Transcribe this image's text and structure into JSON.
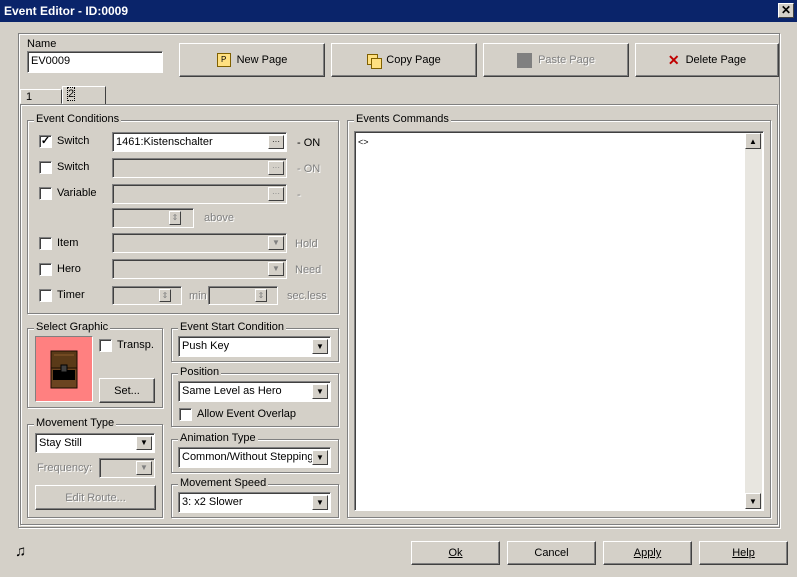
{
  "window": {
    "title": "Event Editor - ID:0009",
    "close_glyph": "✕"
  },
  "name": {
    "label": "Name",
    "value": "EV0009"
  },
  "toolbar": {
    "new_page": "New Page",
    "copy_page": "Copy Page",
    "paste_page": "Paste Page",
    "delete_page": "Delete Page"
  },
  "tabs": [
    "1",
    "2"
  ],
  "event_conditions": {
    "title": "Event Conditions",
    "switch1": {
      "label": "Switch",
      "checked": "✓",
      "value": "1461:Kistenschalter",
      "suffix": "- ON"
    },
    "switch2": {
      "label": "Switch",
      "suffix": "- ON"
    },
    "variable": {
      "label": "Variable",
      "suffix": "-",
      "above": "above"
    },
    "item": {
      "label": "Item",
      "suffix": "Hold"
    },
    "hero": {
      "label": "Hero",
      "suffix": "Need"
    },
    "timer": {
      "label": "Timer",
      "min": "min",
      "sec": "sec.less"
    }
  },
  "select_graphic": {
    "title": "Select Graphic",
    "transp": "Transp.",
    "set": "Set...",
    "bg_color": "#ff8080"
  },
  "movement_type": {
    "title": "Movement Type",
    "value": "Stay Still",
    "frequency": "Frequency:",
    "edit_route": "Edit Route..."
  },
  "event_start": {
    "title": "Event Start Condition",
    "value": "Push Key"
  },
  "position": {
    "title": "Position",
    "value": "Same Level as Hero",
    "overlap": "Allow Event Overlap"
  },
  "animation_type": {
    "title": "Animation Type",
    "value": "Common/Without Stepping"
  },
  "movement_speed": {
    "title": "Movement Speed",
    "value": "3: x2 Slower"
  },
  "events_commands": {
    "title": "Events Commands",
    "first_line": "<>"
  },
  "footer": {
    "ok": "Ok",
    "cancel": "Cancel",
    "apply": "Apply",
    "help": "Help",
    "music_icon": "♫"
  },
  "icons": {
    "ellipsis": "···",
    "down": "▼",
    "up": "▲",
    "spin": "⇕"
  }
}
